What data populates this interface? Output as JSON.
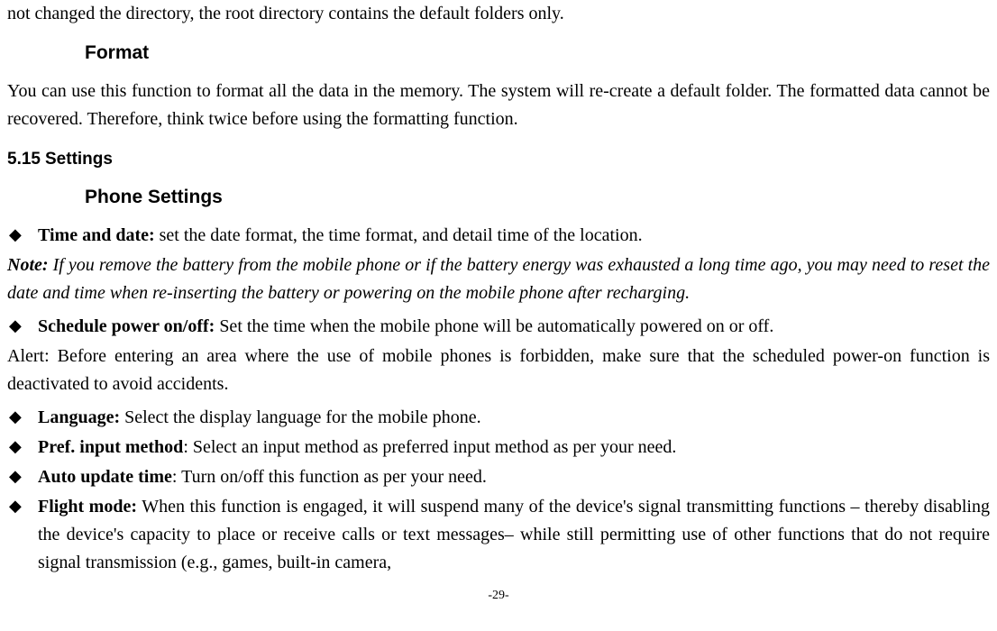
{
  "top_line": "not changed the directory, the root directory contains the default folders only.",
  "format_heading": "Format",
  "format_para": "You can use this function to format all the data in the memory. The system will re-create a default folder. The formatted data cannot be recovered. Therefore, think twice before using the formatting function.",
  "settings_num": "5.15",
  "settings_label": "Settings",
  "phone_settings_heading": "Phone Settings",
  "bullets": {
    "time_date_label": "Time and date:",
    "time_date_text": " set the date format, the time format, and detail time of the location.",
    "schedule_label": "Schedule power on/off:",
    "schedule_text": " Set the time when the mobile phone will be automatically powered on or off.",
    "language_label": "Language:",
    "language_text": " Select the display language for the mobile phone.",
    "pref_label": "Pref. input method",
    "pref_text": ": Select an input method as preferred input method as per your need.",
    "auto_label": "Auto update time",
    "auto_text": ": Turn on/off this function as per your need.",
    "flight_label": "Flight mode:",
    "flight_text": " When this function is engaged, it will suspend many of the device's signal transmitting functions – thereby disabling the device's capacity to place or receive calls or text messages– while still permitting use of other functions that do not require signal transmission (e.g., games, built-in camera,"
  },
  "note_label": "Note:",
  "note_body": " If you remove the battery from the mobile phone or if the battery energy was exhausted a long time ago, you may need to reset the date and time when re-inserting the battery or powering on the mobile phone after recharging.",
  "alert_text": "Alert: Before entering an area where the use of mobile phones is forbidden, make sure that the scheduled power-on function is deactivated to avoid accidents.",
  "page_num": "-29-",
  "diamond": "◆"
}
